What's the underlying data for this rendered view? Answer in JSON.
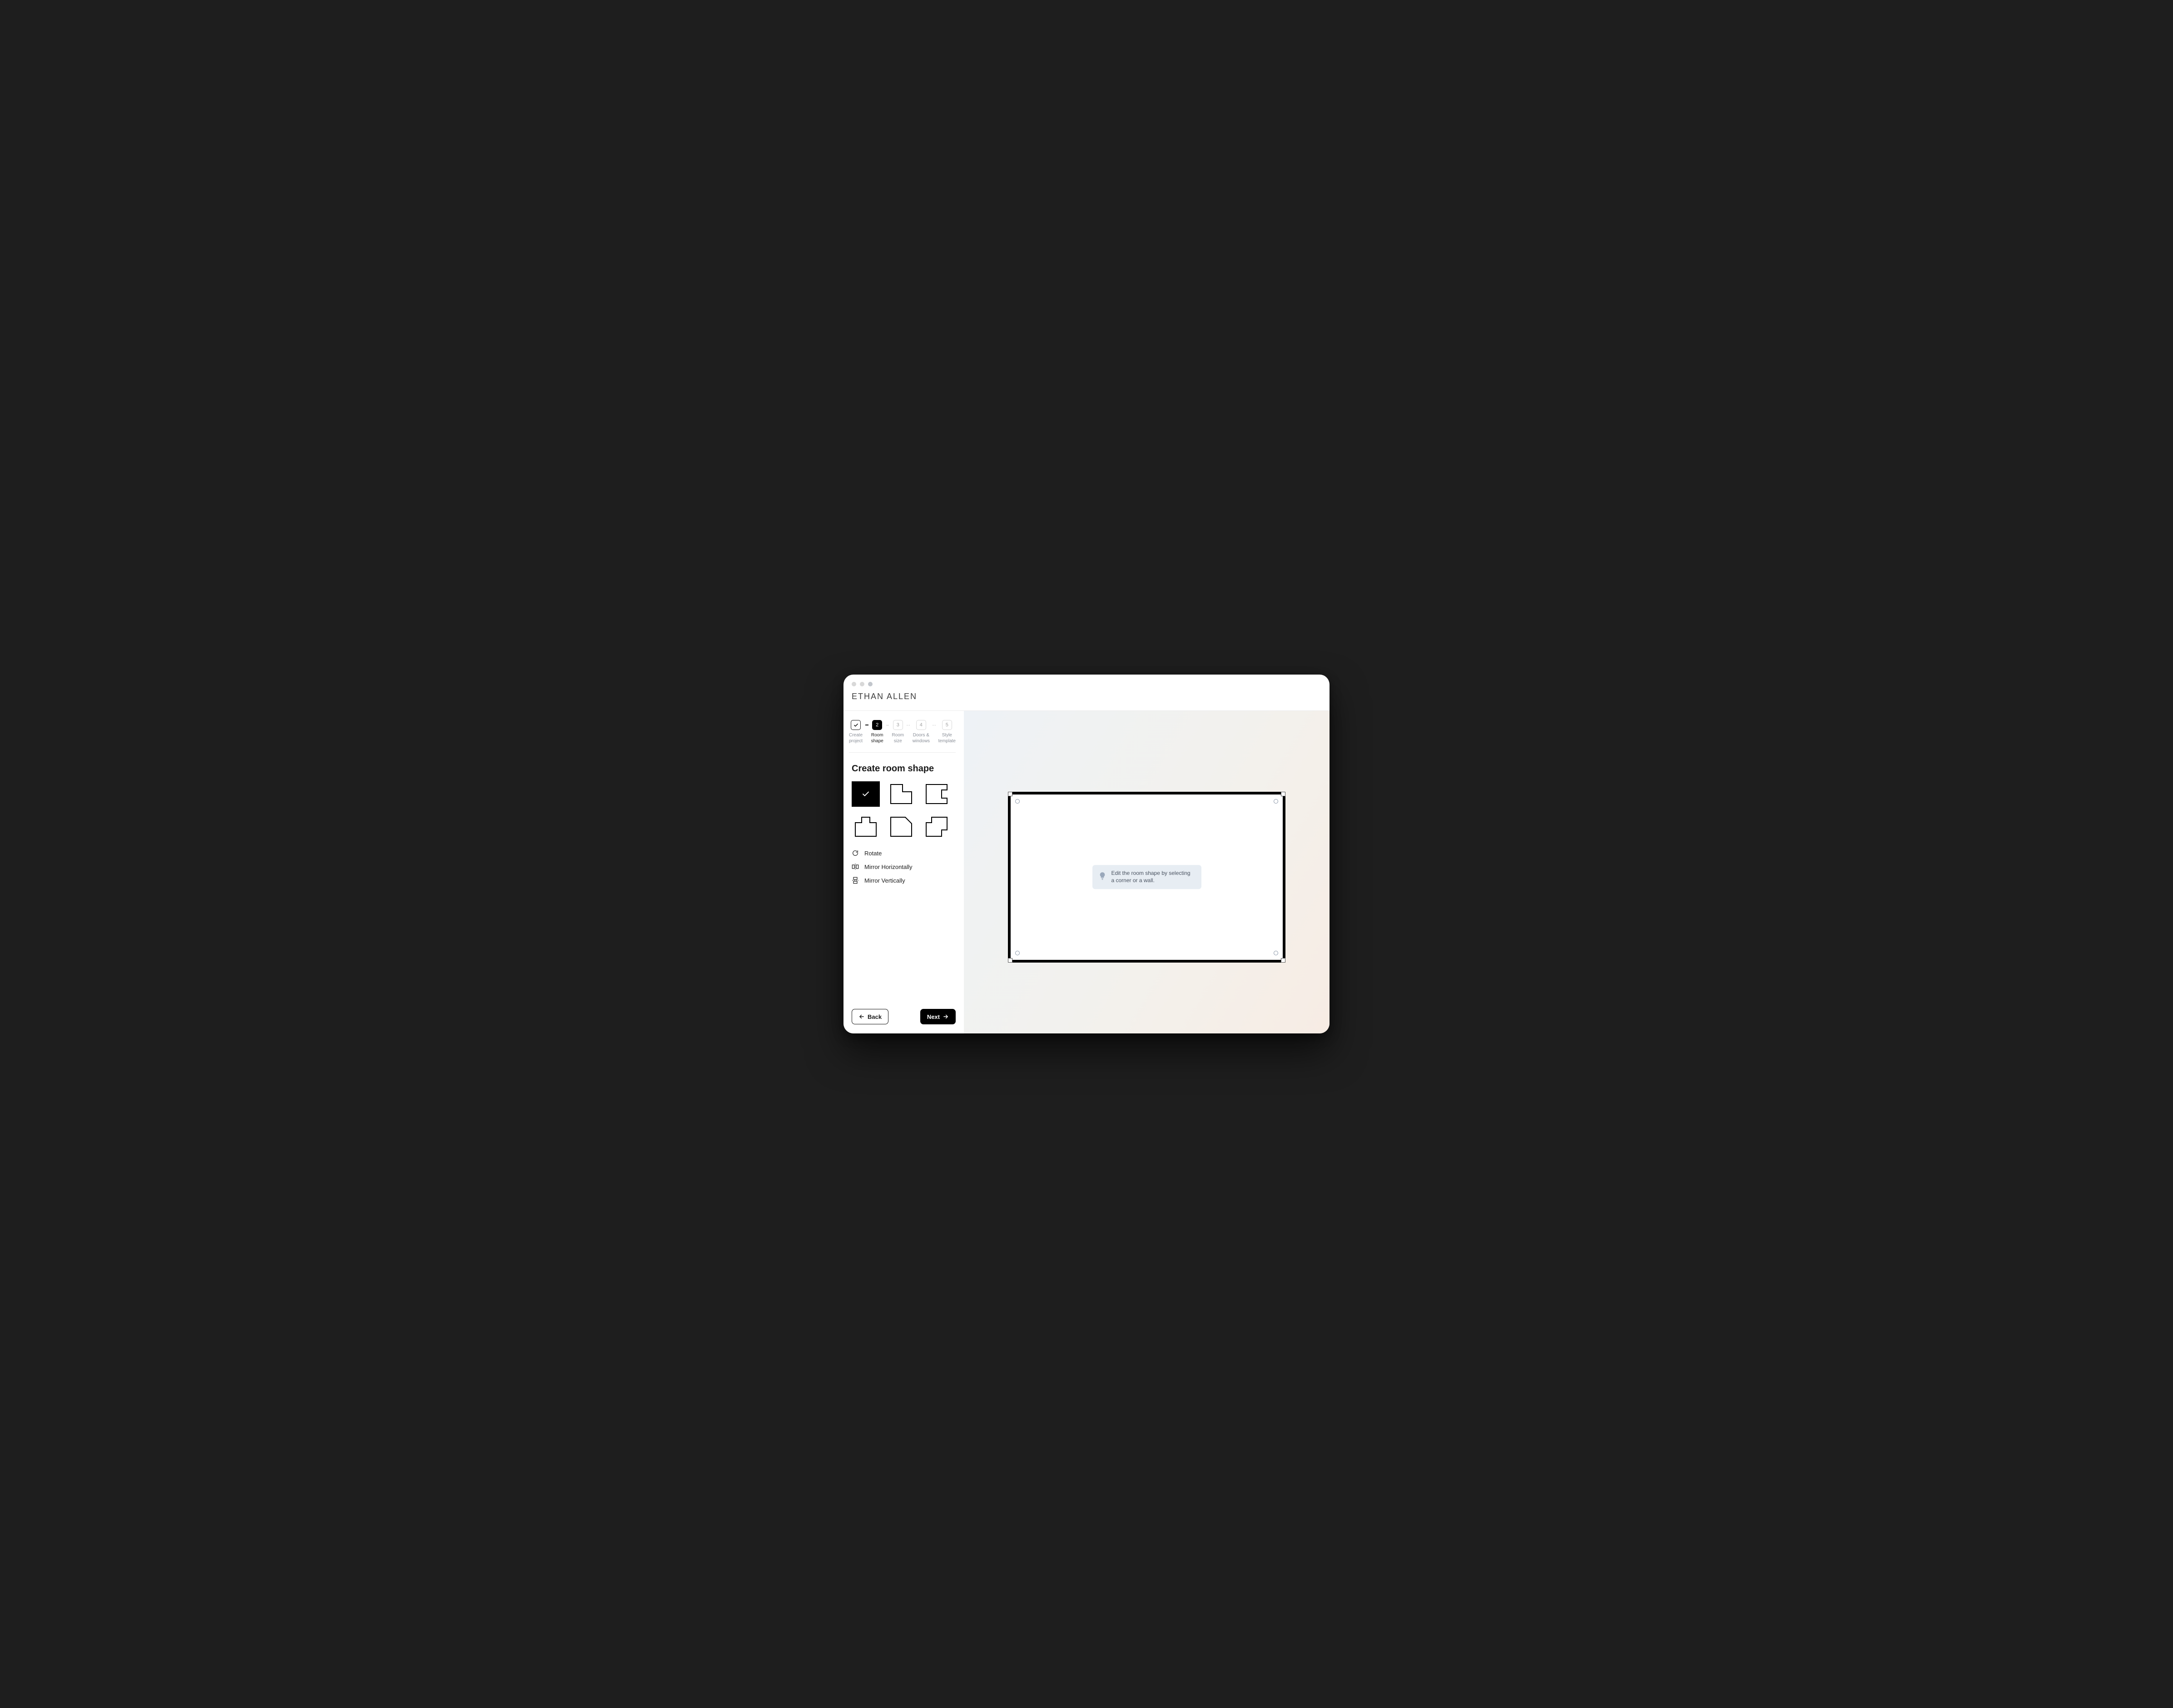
{
  "brand": "ETHAN ALLEN",
  "stepper": {
    "steps": [
      {
        "id": "create-project",
        "label": "Create project",
        "state": "done",
        "number": ""
      },
      {
        "id": "room-shape",
        "label": "Room shape",
        "state": "active",
        "number": "2"
      },
      {
        "id": "room-size",
        "label": "Room size",
        "state": "pending",
        "number": "3"
      },
      {
        "id": "doors-windows",
        "label": "Doors & windows",
        "state": "pending",
        "number": "4"
      },
      {
        "id": "style-template",
        "label": "Style template",
        "state": "pending",
        "number": "5"
      }
    ]
  },
  "section_title": "Create room shape",
  "shapes": [
    {
      "id": "rect",
      "selected": true
    },
    {
      "id": "l-topright",
      "selected": false
    },
    {
      "id": "notch-right",
      "selected": false
    },
    {
      "id": "t-top",
      "selected": false
    },
    {
      "id": "cut-corner",
      "selected": false
    },
    {
      "id": "step-corner",
      "selected": false
    }
  ],
  "tools": {
    "rotate": "Rotate",
    "mirror_h": "Mirror Horizontally",
    "mirror_v": "Mirror Vertically"
  },
  "buttons": {
    "back": "Back",
    "next": "Next"
  },
  "canvas": {
    "hint": "Edit the room shape by selecting a corner or a wall."
  }
}
